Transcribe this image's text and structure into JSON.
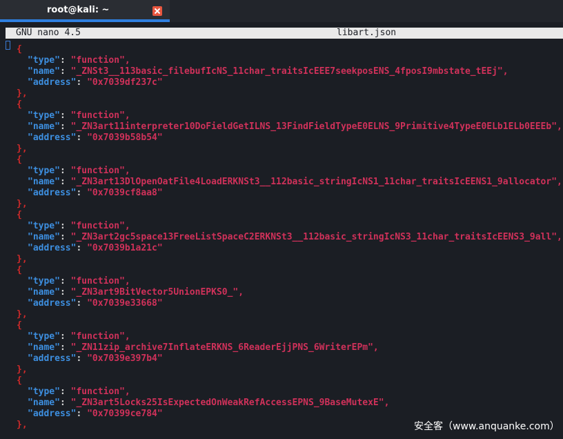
{
  "window": {
    "tab_title": "root@kali: ~",
    "close_icon": "close-icon"
  },
  "nano": {
    "version": "GNU nano 4.5",
    "filename": "libart.json"
  },
  "file": {
    "open_bracket": "[",
    "entries": [
      {
        "type": "function",
        "name": "_ZNSt3__113basic_filebufIcNS_11char_traitsIcEEE7seekposENS_4fposI9mbstate_tEEj",
        "address": "0x7039df237c"
      },
      {
        "type": "function",
        "name": "_ZN3art11interpreter10DoFieldGetILNS_13FindFieldTypeE0ELNS_9Primitive4TypeE0ELb1ELb0EEEb",
        "address": "0x7039b58b54"
      },
      {
        "type": "function",
        "name": "_ZN3art13DlOpenOatFile4LoadERKNSt3__112basic_stringIcNS1_11char_traitsIcEENS1_9allocator",
        "address": "0x7039cf8aa8"
      },
      {
        "type": "function",
        "name": "_ZN3art2gc5space13FreeListSpaceC2ERKNSt3__112basic_stringIcNS3_11char_traitsIcEENS3_9all",
        "address": "0x7039b1a21c"
      },
      {
        "type": "function",
        "name": "_ZN3art9BitVector5UnionEPKS0_",
        "address": "0x7039e33668"
      },
      {
        "type": "function",
        "name": "_ZN11zip_archive7InflateERKNS_6ReaderEjjPNS_6WriterEPm",
        "address": "0x7039e397b4"
      },
      {
        "type": "function",
        "name": "_ZN3art5Locks25IsExpectedOnWeakRefAccessEPNS_9BaseMutexE",
        "address": "0x70399ce784"
      }
    ]
  },
  "watermark": "安全客（www.anquanke.com）",
  "colors": {
    "background": "#1b1e24",
    "brace": "#d02a2a",
    "key": "#3d8fe0",
    "string": "#d0315a",
    "tab_accent": "#2f7fe0",
    "close_button": "#e8563f"
  }
}
